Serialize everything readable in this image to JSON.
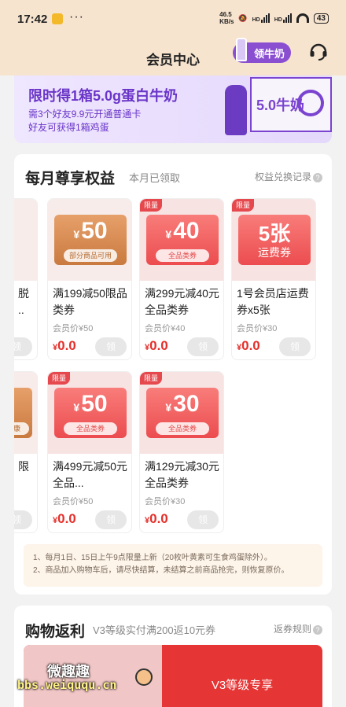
{
  "status_bar": {
    "time": "17:42",
    "more": "···",
    "net_speed_top": "46.5",
    "net_speed_unit": "KB/s",
    "hd1": "HD",
    "hd2": "HD",
    "battery": "43"
  },
  "header": {
    "title": "会员中心",
    "milk_button": "领牛奶"
  },
  "banner": {
    "headline": "限时得1箱5.0g蛋白牛奶",
    "line1": "需3个好友9.9元开通普通卡",
    "line2": "好友可获得1箱鸡蛋",
    "box_text": "5.0牛奶"
  },
  "benefits": {
    "title": "每月尊享权益",
    "subtitle": "本月已领取",
    "record_link": "权益兑换记录",
    "coupons": [
      {
        "limit": "",
        "currency": "¥",
        "amount": "50",
        "tag": "部分商品可用",
        "name": "满199减50限品类券",
        "member_price": "会员价¥50",
        "price_cur": "¥",
        "price": "0.0",
        "claim": "领"
      },
      {
        "limit": "限量",
        "currency": "¥",
        "amount": "40",
        "tag": "全品类券",
        "name": "满299元减40元全品类券",
        "member_price": "会员价¥40",
        "price_cur": "¥",
        "price": "0.0",
        "claim": "领"
      },
      {
        "limit": "限量",
        "currency": "",
        "amount": "5张",
        "tag": "运费券",
        "name": "1号会员店运费券x5张",
        "member_price": "会员价¥30",
        "price_cur": "¥",
        "price": "0.0",
        "claim": "领"
      },
      {
        "limit": "限量",
        "currency": "¥",
        "amount": "50",
        "tag": "全品类券",
        "name": "满499元减50元全品...",
        "member_price": "会员价¥50",
        "price_cur": "¥",
        "price": "0.0",
        "claim": "领"
      },
      {
        "limit": "限量",
        "currency": "¥",
        "amount": "30",
        "tag": "全品类券",
        "name": "满129元减30元全品类券",
        "member_price": "会员价¥30",
        "price_cur": "¥",
        "price": "0.0",
        "claim": "领"
      }
    ],
    "partial_left_top": {
      "name_a": "脱",
      "name_b": "..",
      "claim": "领"
    },
    "partial_left_bottom": {
      "tag": "健康",
      "name_a": "限",
      "claim": "领"
    },
    "rules": [
      "1、每月1日、15日上午9点限量上新（20枚叶黄素可生食鸡蛋除外）。",
      "2、商品加入购物车后，请尽快结算，未结算之前商品抢完，则恢复原价。"
    ]
  },
  "rebate": {
    "title": "购物返利",
    "subtitle": "V3等级实付满200返10元券",
    "rule_link": "返券规则",
    "level_label": "V3等级专享"
  },
  "watermark": {
    "line1": "微趣趣",
    "line2": "bbs.weiququ.cn"
  }
}
